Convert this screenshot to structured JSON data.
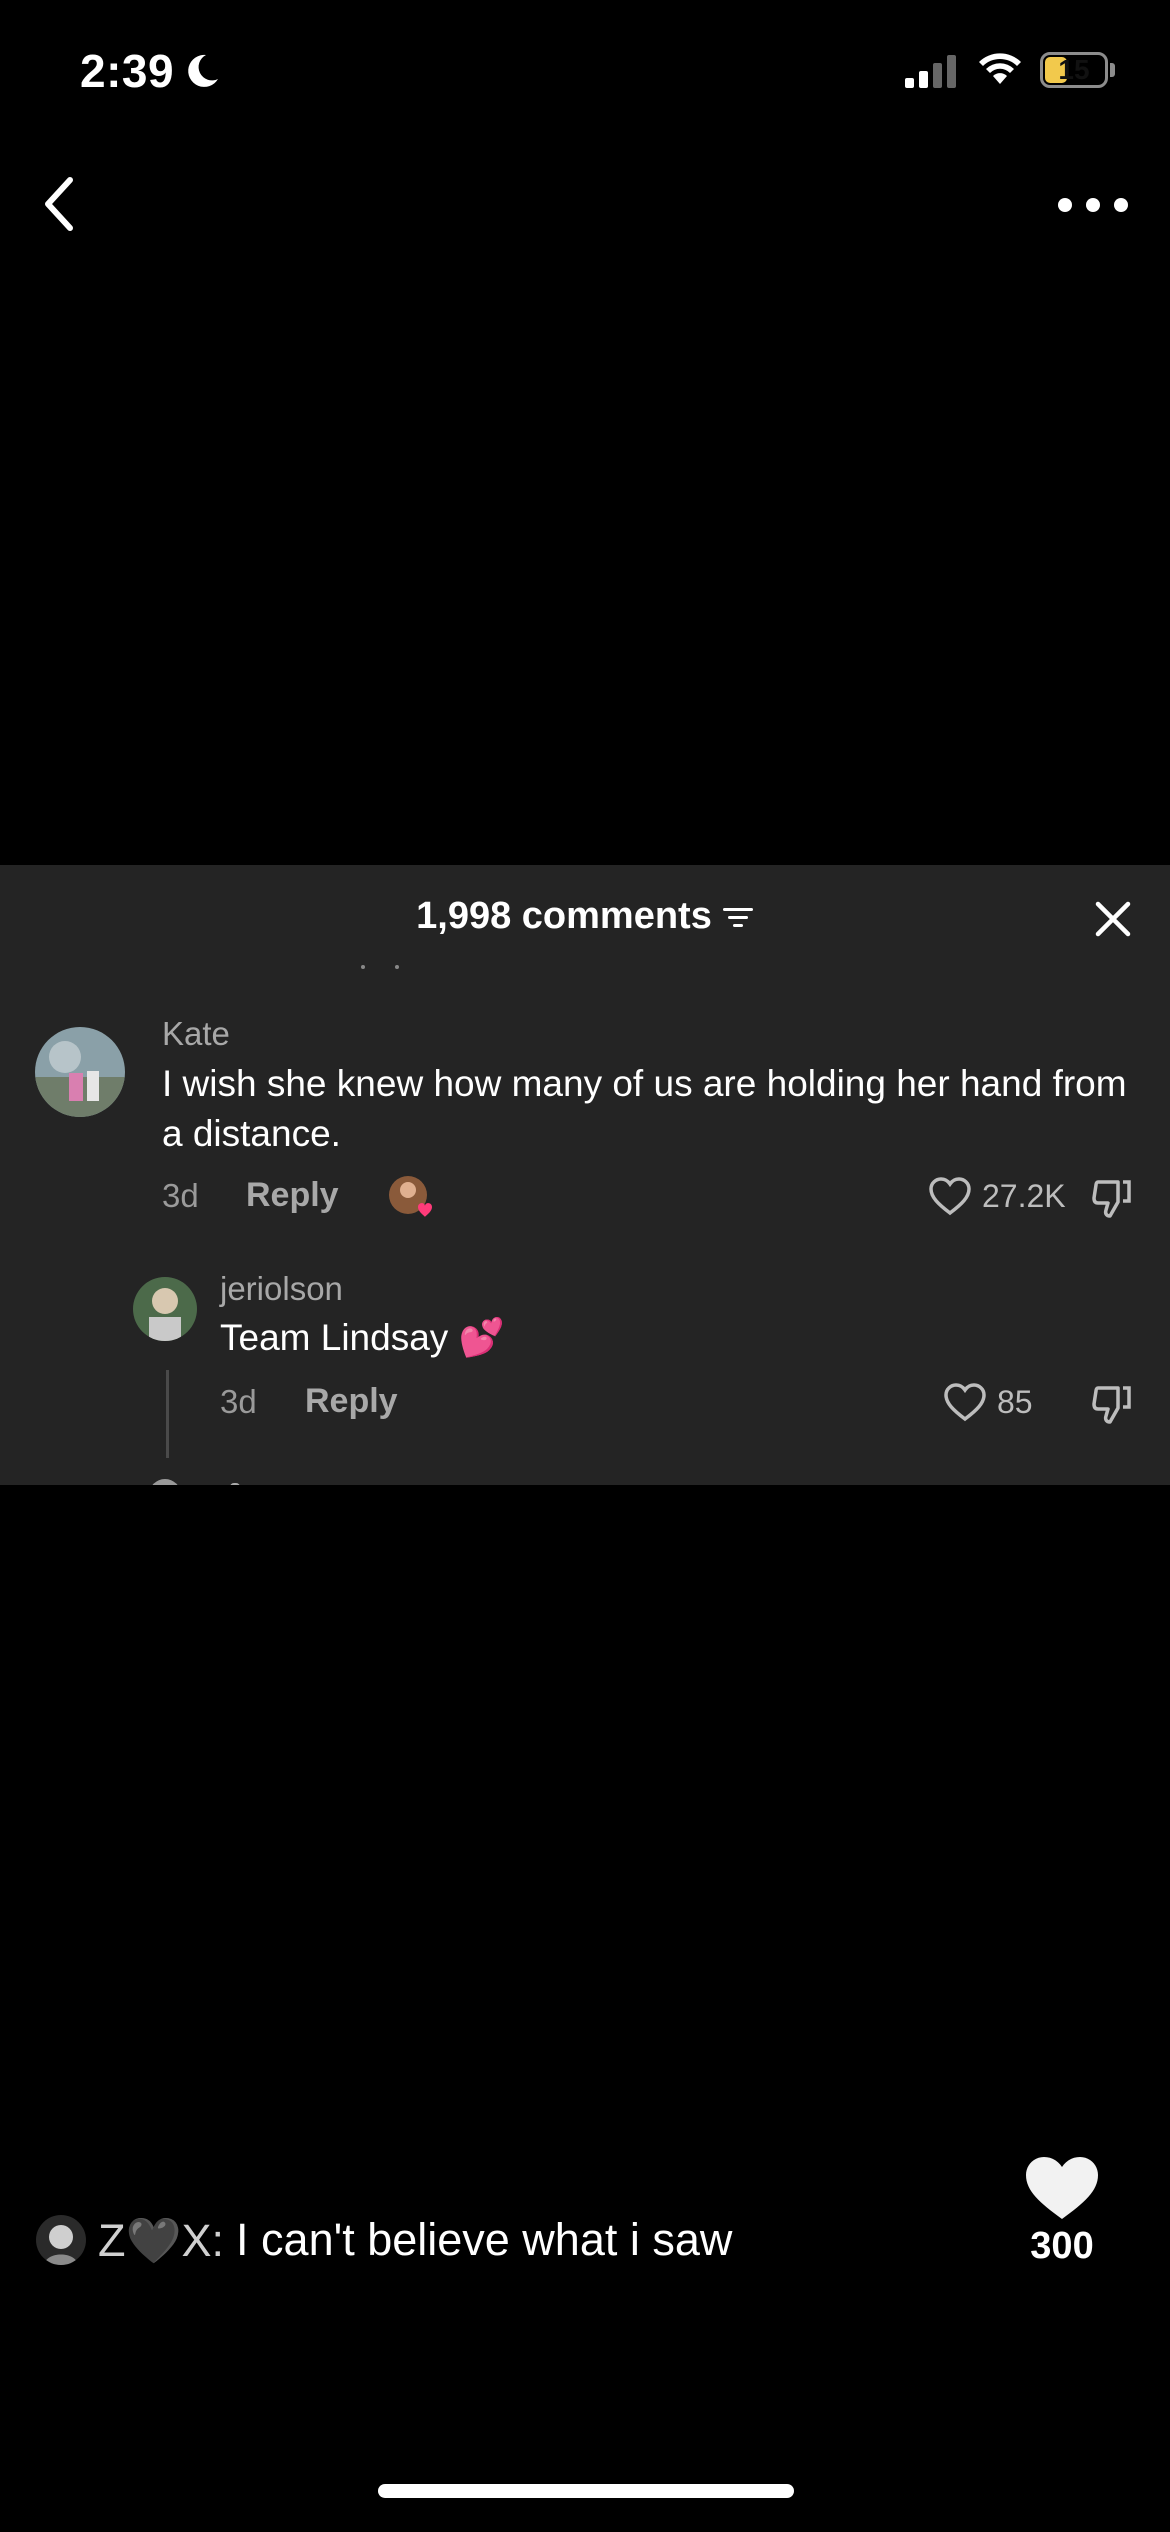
{
  "status_bar": {
    "time": "2:39",
    "battery_level": "15",
    "icons": [
      "moon-icon",
      "cellular-signal-icon",
      "wifi-icon",
      "battery-icon"
    ]
  },
  "nav": {
    "back_icon": "chevron-left-icon",
    "more_icon": "ellipsis-icon"
  },
  "comments": {
    "title": "1,998 comments",
    "filter_icon": "filter-icon",
    "close_icon": "close-icon",
    "items": [
      {
        "username": "Kate",
        "text": "I wish she knew how many of us are holding her hand from a distance.",
        "age": "3d",
        "reply_label": "Reply",
        "likes": "27.2K"
      },
      {
        "username": "jeriolson",
        "text": "Team Lindsay 💕",
        "age": "3d",
        "reply_label": "Reply",
        "likes": "85"
      }
    ]
  },
  "caption": {
    "user": "Z🖤X:",
    "text": "I can't believe what i saw"
  },
  "like": {
    "count": "300",
    "icon": "heart-icon"
  },
  "colors": {
    "background": "#000000",
    "panel": "#242424",
    "battery": "#f2c94c",
    "text_secondary": "#a8a8a8"
  }
}
